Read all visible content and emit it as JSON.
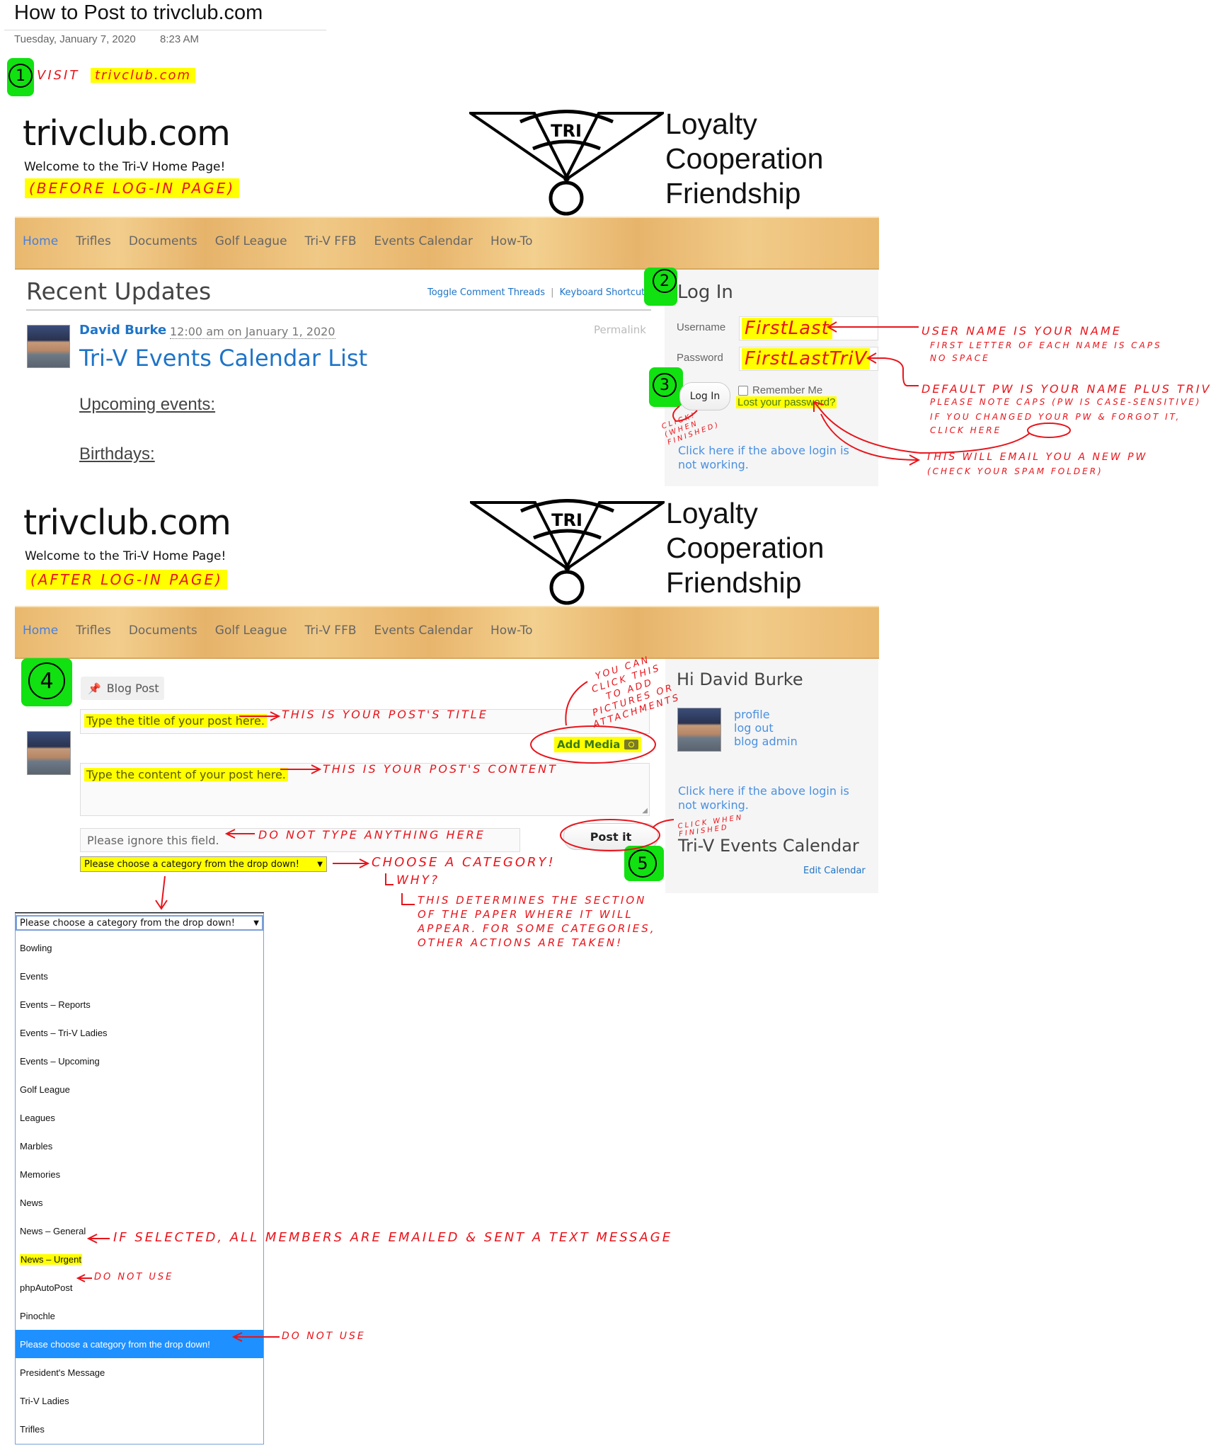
{
  "note": {
    "title": "How to Post to trivclub.com",
    "date": "Tuesday, January 7, 2020",
    "time": "8:23 AM"
  },
  "steps": {
    "step1": "1",
    "step2": "2",
    "step3": "3",
    "step4": "4",
    "step5": "5",
    "step1_text": "Visit",
    "step1_link": "trivclub.com"
  },
  "site": {
    "title": "trivclub.com",
    "tagline": "Welcome to the Tri-V Home Page!",
    "logo_text": "TRI",
    "mottos": [
      "Loyalty",
      "Cooperation",
      "Friendship"
    ],
    "nav": [
      "Home",
      "Trifles",
      "Documents",
      "Golf League",
      "Tri-V FFB",
      "Events Calendar",
      "How-To"
    ],
    "active_nav": "Home",
    "colors": {
      "link": "#1e74c8",
      "accent_highlight": "#ffff00",
      "annotation": "#e8141b",
      "step_marker": "#11e011",
      "selected_option": "#1e90ff"
    }
  },
  "before_login": {
    "label": "(Before Log-In Page)",
    "recent_title": "Recent Updates",
    "toggle_comments": "Toggle Comment Threads",
    "separator": "|",
    "keyboard_shortcuts": "Keyboard Shortcuts",
    "post": {
      "author": "David Burke",
      "timestamp": "12:00 am on January 1, 2020",
      "permalink": "Permalink",
      "title": "Tri-V Events Calendar List",
      "sections": [
        "Upcoming events:",
        "Birthdays:"
      ]
    },
    "login": {
      "title": "Log In",
      "username_label": "Username",
      "username_value": "FirstLast",
      "password_label": "Password",
      "password_value": "FirstLastTriV",
      "login_button": "Log In",
      "remember_me": "Remember Me",
      "remember_checked": false,
      "lost_password": "Lost your password?",
      "help_link": "Click here if the above login is not working."
    },
    "annotations": {
      "click_when_finished": "Click! (When finished)",
      "username_note": "User name is your name",
      "username_sub1": "First letter of each name is caps",
      "username_sub2": "No space",
      "password_note": "Default PW is your name plus TriV",
      "password_sub1": "Please note caps (PW is case-sensitive)",
      "password_sub2": "If you changed your PW & forgot it, click here",
      "reset_note": "This will email you a new PW",
      "reset_sub": "(Check your spam folder)"
    }
  },
  "after_login": {
    "label": "(After Log-In Page)",
    "blog_post_tab": "Blog Post",
    "title_placeholder": "Type the title of your post here.",
    "add_media": "Add Media",
    "content_placeholder": "Type the content of your post here.",
    "ignore_placeholder": "Please ignore this field.",
    "post_button": "Post it",
    "category_selected": "Please choose a category from the drop down!",
    "side": {
      "greeting": "Hi David Burke",
      "links": [
        "profile",
        "log out",
        "blog admin"
      ],
      "help_link": "Click here if the above login is not working.",
      "calendar_title": "Tri-V Events Calendar",
      "edit_calendar": "Edit Calendar"
    },
    "annotations": {
      "title_note": "This is your post's title",
      "content_note": "This is your post's content",
      "media_note": "You can click this to add pictures or attachments",
      "ignore_note": "Do not type anything here",
      "post_note": "Click when finished",
      "category_note": "Choose a category!",
      "category_why": "Why?",
      "category_reason": [
        "This determines the section",
        "of the paper where it will",
        "appear. For some categories,",
        "other actions are taken!"
      ]
    }
  },
  "dropdown": {
    "header": "Please choose a category from the drop down!",
    "options": [
      "Bowling",
      "Events",
      "Events – Reports",
      "Events – Tri-V Ladies",
      "Events – Upcoming",
      "Golf League",
      "Leagues",
      "Marbles",
      "Memories",
      "News",
      "News – General",
      "News – Urgent",
      "phpAutoPost",
      "Pinochle",
      "Please choose a category from the drop down!",
      "President's Message",
      "Tri-V Ladies",
      "Trifles"
    ],
    "selected_index": 14,
    "highlighted_index": 11,
    "annotations": {
      "urgent_note": "If selected, all members are emailed & sent a text message",
      "autopost_note": "Do not use",
      "placeholder_note": "Do not use"
    }
  }
}
